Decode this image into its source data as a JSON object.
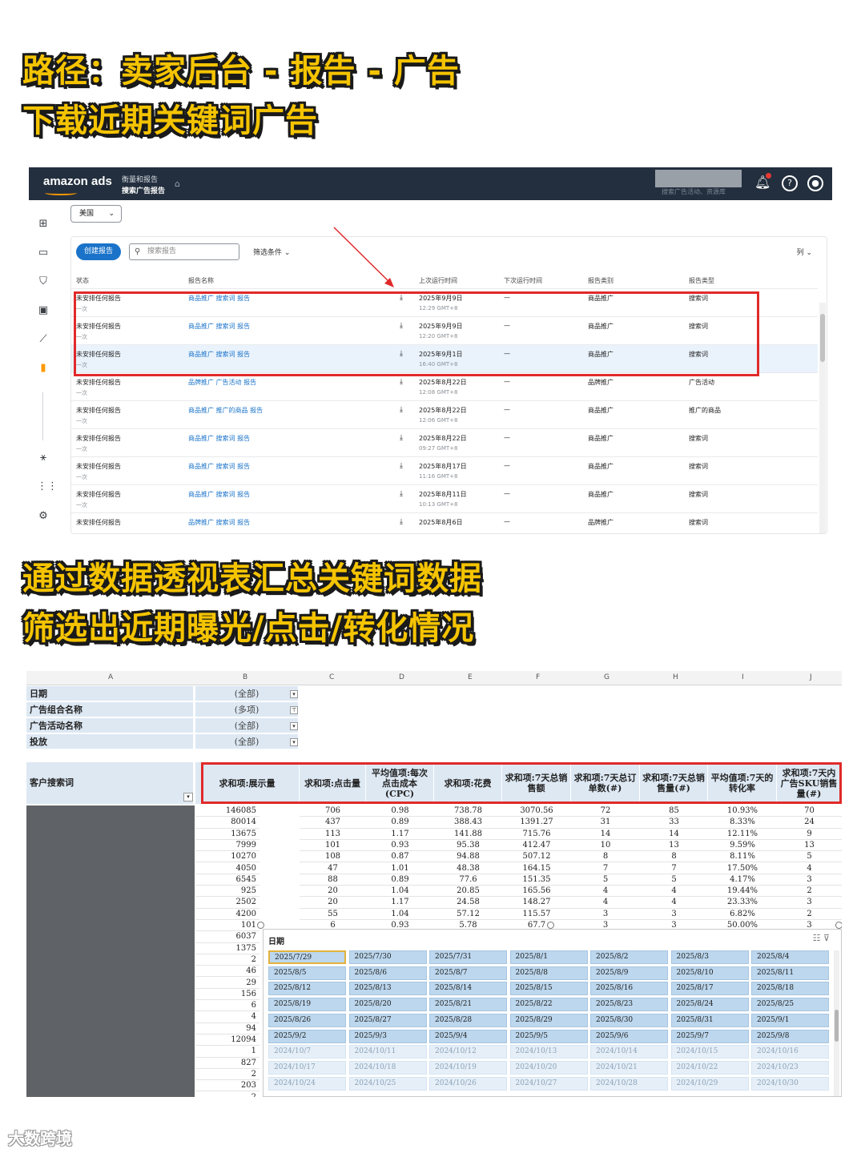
{
  "headings": {
    "line1": "路径：卖家后台 - 报告 - 广告",
    "line2": "下载近期关键词广告",
    "line3": "通过数据透视表汇总关键词数据",
    "line4": "筛选出近期曝光/点击/转化情况"
  },
  "amazon_ads": {
    "logo": "amazon ads",
    "crumb_parent": "衡量和报告",
    "crumb_current": "搜索广告报告",
    "blurred_hint": "搜索广告活动、资源库",
    "marketplace": "美国",
    "create_button": "创建报告",
    "search_placeholder": "搜索报告",
    "filter_label": "筛选条件",
    "columns_label": "列",
    "table_headers": [
      "状态",
      "报告名称",
      "上次运行时间",
      "下次运行时间",
      "报告类别",
      "报告类型"
    ],
    "rows": [
      {
        "status": "未安排任何报告",
        "freq": "一次",
        "name": "商品推广 搜索词 报告",
        "date": "2025年9月9日",
        "time": "12:29 GMT+8",
        "next": "—",
        "category": "商品推广",
        "type": "搜索词"
      },
      {
        "status": "未安排任何报告",
        "freq": "一次",
        "name": "商品推广 搜索词 报告",
        "date": "2025年9月9日",
        "time": "12:20 GMT+8",
        "next": "—",
        "category": "商品推广",
        "type": "搜索词"
      },
      {
        "status": "未安排任何报告",
        "freq": "一次",
        "name": "商品推广 搜索词 报告",
        "date": "2025年9月1日",
        "time": "16:40 GMT+8",
        "next": "—",
        "category": "商品推广",
        "type": "搜索词"
      },
      {
        "status": "未安排任何报告",
        "freq": "一次",
        "name": "品牌推广 广告活动 报告",
        "date": "2025年8月22日",
        "time": "12:08 GMT+8",
        "next": "—",
        "category": "品牌推广",
        "type": "广告活动"
      },
      {
        "status": "未安排任何报告",
        "freq": "一次",
        "name": "商品推广 推广的商品 报告",
        "date": "2025年8月22日",
        "time": "12:06 GMT+8",
        "next": "—",
        "category": "商品推广",
        "type": "推广的商品"
      },
      {
        "status": "未安排任何报告",
        "freq": "一次",
        "name": "商品推广 搜索词 报告",
        "date": "2025年8月22日",
        "time": "09:27 GMT+8",
        "next": "—",
        "category": "商品推广",
        "type": "搜索词"
      },
      {
        "status": "未安排任何报告",
        "freq": "一次",
        "name": "商品推广 搜索词 报告",
        "date": "2025年8月17日",
        "time": "11:16 GMT+8",
        "next": "—",
        "category": "商品推广",
        "type": "搜索词"
      },
      {
        "status": "未安排任何报告",
        "freq": "一次",
        "name": "商品推广 搜索词 报告",
        "date": "2025年8月11日",
        "time": "10:13 GMT+8",
        "next": "—",
        "category": "商品推广",
        "type": "搜索词"
      },
      {
        "status": "未安排任何报告",
        "freq": "",
        "name": "品牌推广 搜索词 报告",
        "date": "2025年8月6日",
        "time": "",
        "next": "—",
        "category": "品牌推广",
        "type": "搜索词"
      }
    ]
  },
  "excel": {
    "column_letters": [
      "A",
      "B",
      "C",
      "D",
      "E",
      "F",
      "G",
      "H",
      "I",
      "J"
    ],
    "filters": [
      {
        "label": "日期",
        "value": "(全部)"
      },
      {
        "label": "广告组合名称",
        "value": "(多项)"
      },
      {
        "label": "广告活动名称",
        "value": "(全部)"
      },
      {
        "label": "投放",
        "value": "(全部)"
      }
    ],
    "row_label": "客户搜索词",
    "headers": [
      "求和项:展示量",
      "求和项:点击量",
      "平均值项:每次点击成本(CPC)",
      "求和项:花费",
      "求和项:7天总销售额",
      "求和项:7天总订单数(#)",
      "求和项:7天总销售量(#)",
      "平均值项:7天的转化率",
      "求和项:7天内广告SKU销售量(#)"
    ],
    "rows": [
      [
        "146085",
        "706",
        "0.98",
        "738.78",
        "3070.56",
        "72",
        "85",
        "10.93%",
        "70"
      ],
      [
        "80014",
        "437",
        "0.89",
        "388.43",
        "1391.27",
        "31",
        "33",
        "8.33%",
        "24"
      ],
      [
        "13675",
        "113",
        "1.17",
        "141.88",
        "715.76",
        "14",
        "14",
        "12.11%",
        "9"
      ],
      [
        "7999",
        "101",
        "0.93",
        "95.38",
        "412.47",
        "10",
        "13",
        "9.59%",
        "13"
      ],
      [
        "10270",
        "108",
        "0.87",
        "94.88",
        "507.12",
        "8",
        "8",
        "8.11%",
        "5"
      ],
      [
        "4050",
        "47",
        "1.01",
        "48.38",
        "164.15",
        "7",
        "7",
        "17.50%",
        "4"
      ],
      [
        "6545",
        "88",
        "0.89",
        "77.6",
        "151.35",
        "5",
        "5",
        "4.17%",
        "3"
      ],
      [
        "925",
        "20",
        "1.04",
        "20.85",
        "165.56",
        "4",
        "4",
        "19.44%",
        "2"
      ],
      [
        "2502",
        "20",
        "1.17",
        "24.58",
        "148.27",
        "4",
        "4",
        "23.33%",
        "3"
      ],
      [
        "4200",
        "55",
        "1.04",
        "57.12",
        "115.57",
        "3",
        "3",
        "6.82%",
        "2"
      ],
      [
        "101",
        "6",
        "0.93",
        "5.78",
        "67.7",
        "3",
        "3",
        "50.00%",
        "3"
      ]
    ],
    "extra_b_values": [
      "6037",
      "1375",
      "2",
      "46",
      "29",
      "156",
      "6",
      "4",
      "94",
      "12094",
      "1",
      "827",
      "2",
      "203",
      "2"
    ],
    "slicer_title": "日期",
    "slicer_dates": [
      [
        "2025/7/29",
        "2025/7/30",
        "2025/7/31",
        "2025/8/1",
        "2025/8/2",
        "2025/8/3",
        "2025/8/4"
      ],
      [
        "2025/8/5",
        "2025/8/6",
        "2025/8/7",
        "2025/8/8",
        "2025/8/9",
        "2025/8/10",
        "2025/8/11"
      ],
      [
        "2025/8/12",
        "2025/8/13",
        "2025/8/14",
        "2025/8/15",
        "2025/8/16",
        "2025/8/17",
        "2025/8/18"
      ],
      [
        "2025/8/19",
        "2025/8/20",
        "2025/8/21",
        "2025/8/22",
        "2025/8/23",
        "2025/8/24",
        "2025/8/25"
      ],
      [
        "2025/8/26",
        "2025/8/27",
        "2025/8/28",
        "2025/8/29",
        "2025/8/30",
        "2025/8/31",
        "2025/9/1"
      ],
      [
        "2025/9/2",
        "2025/9/3",
        "2025/9/4",
        "2025/9/5",
        "2025/9/6",
        "2025/9/7",
        "2025/9/8"
      ],
      [
        "2024/10/7",
        "2024/10/11",
        "2024/10/12",
        "2024/10/13",
        "2024/10/14",
        "2024/10/15",
        "2024/10/16"
      ],
      [
        "2024/10/17",
        "2024/10/18",
        "2024/10/19",
        "2024/10/20",
        "2024/10/21",
        "2024/10/22",
        "2024/10/23"
      ],
      [
        "2024/10/24",
        "2024/10/25",
        "2024/10/26",
        "2024/10/27",
        "2024/10/28",
        "2024/10/29",
        "2024/10/30"
      ]
    ]
  },
  "watermark": "大数跨境"
}
